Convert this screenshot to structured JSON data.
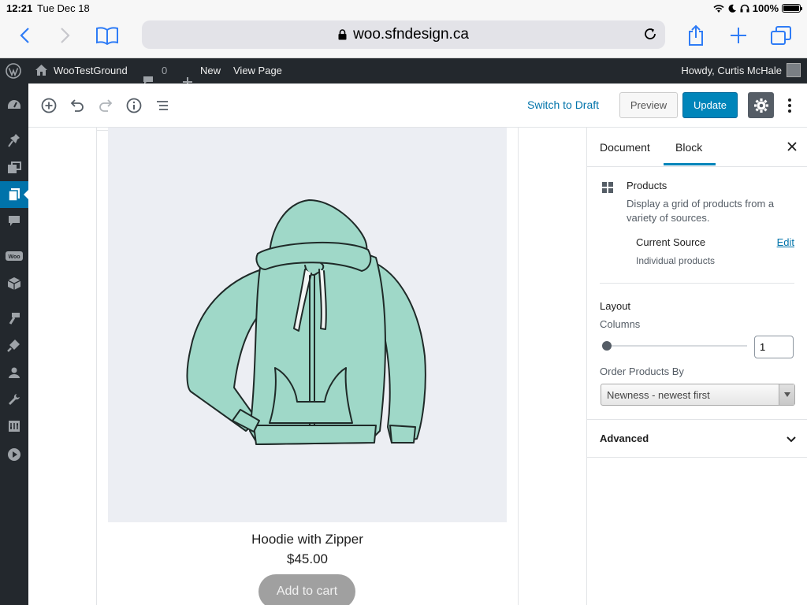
{
  "status_bar": {
    "time": "12:21",
    "date": "Tue Dec 18",
    "battery": "100%"
  },
  "browser": {
    "url": "woo.sfndesign.ca"
  },
  "admin_bar": {
    "site_name": "WooTestGround",
    "comments_count": "0",
    "new_label": "New",
    "view_page_label": "View Page",
    "howdy": "Howdy, Curtis McHale"
  },
  "editor_header": {
    "switch_to_draft": "Switch to Draft",
    "preview": "Preview",
    "update": "Update"
  },
  "product": {
    "name": "Hoodie with Zipper",
    "price": "$45.00",
    "add_to_cart": "Add to cart"
  },
  "sidebar": {
    "tabs": [
      "Document",
      "Block"
    ],
    "active_tab": "Block",
    "block": {
      "title": "Products",
      "description": "Display a grid of products from a variety of sources."
    },
    "source": {
      "label": "Current Source",
      "edit": "Edit",
      "value": "Individual products"
    },
    "layout": {
      "title": "Layout",
      "columns_label": "Columns",
      "columns_value": "1",
      "order_label": "Order Products By",
      "order_value": "Newness - newest first"
    },
    "advanced": "Advanced"
  },
  "colors": {
    "accent": "#0085ba",
    "admin_bg": "#23282d",
    "link": "#0073aa",
    "hoodie": "#9fd8c8"
  }
}
